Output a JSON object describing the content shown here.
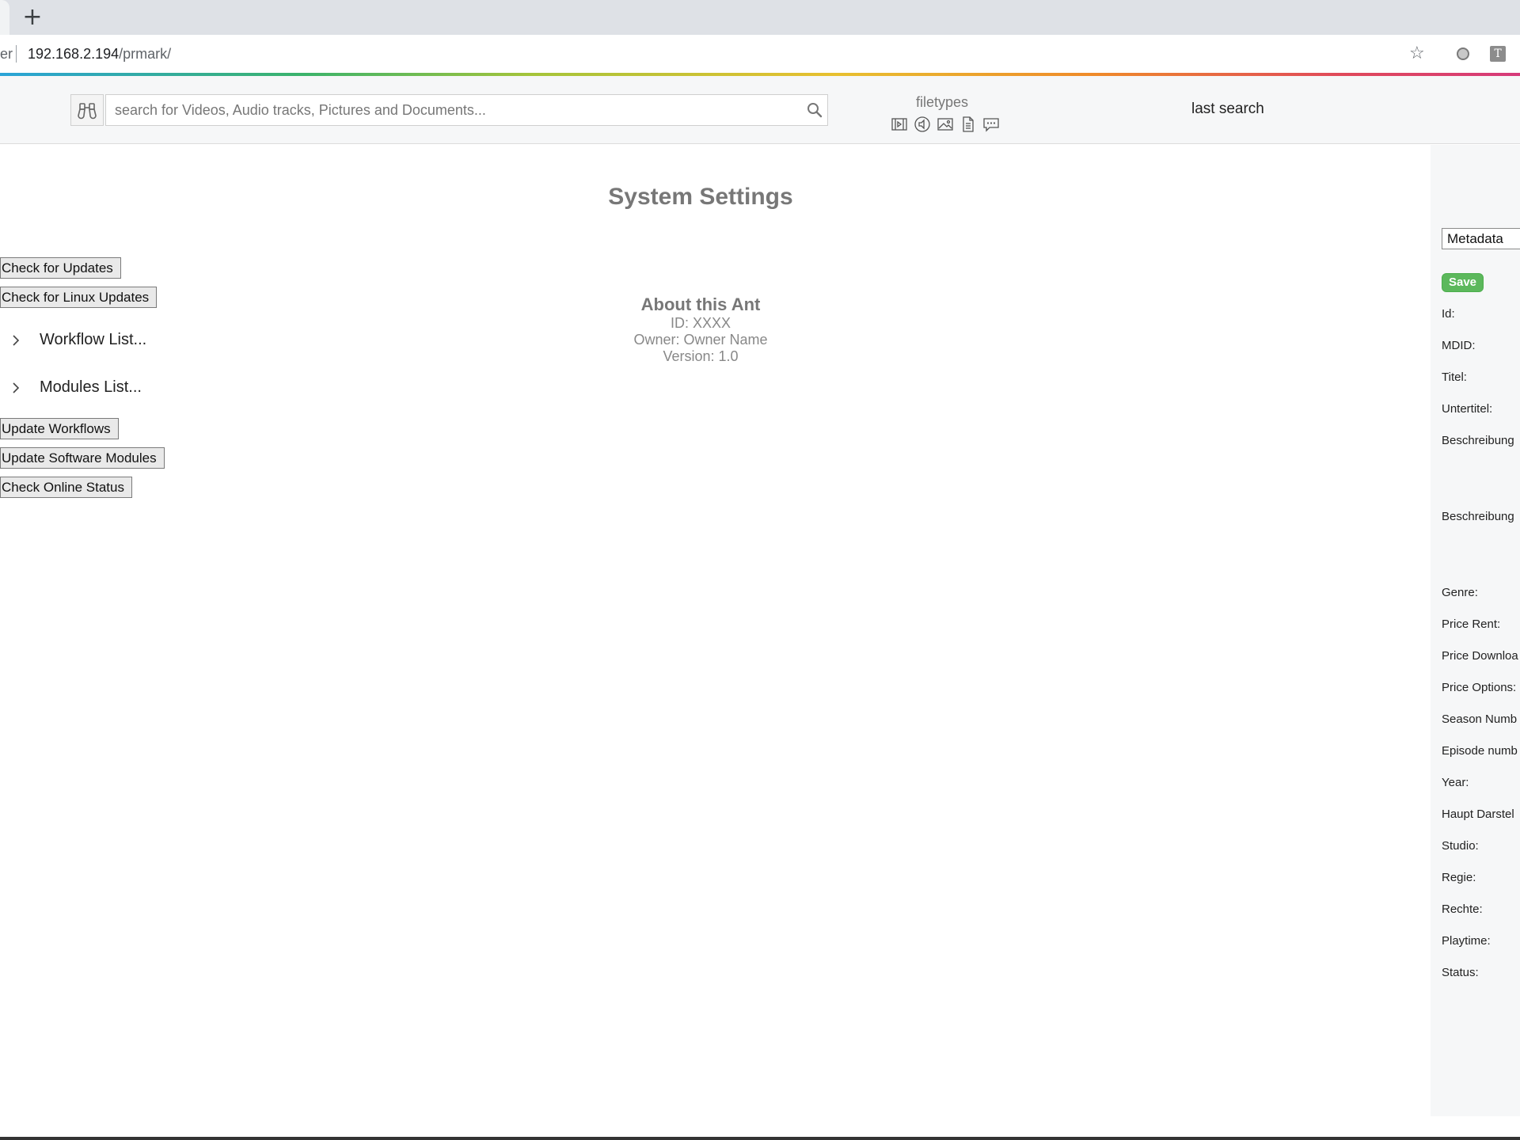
{
  "browser": {
    "new_tab": "+",
    "omnibox_prefix": "er",
    "url_host": "192.168.2.194",
    "url_path": "/prmark/",
    "extension_letter": "T"
  },
  "header": {
    "search_placeholder": "search for Videos, Audio tracks, Pictures and Documents...",
    "filetypes_label": "filetypes",
    "filetype_icons": [
      "video-icon",
      "audio-icon",
      "picture-icon",
      "document-icon",
      "comment-icon"
    ],
    "last_search_label": "last search"
  },
  "main": {
    "title": "System Settings",
    "about": {
      "title": "About this Ant",
      "id": "ID: XXXX",
      "owner": "Owner: Owner Name",
      "version": "Version: 1.0"
    }
  },
  "actions": {
    "check_updates": "Check for Updates",
    "check_linux_updates": "Check for Linux Updates",
    "workflow_list": "Workflow List...",
    "modules_list": "Modules List...",
    "update_workflows": "Update Workflows",
    "update_software_modules": "Update Software Modules",
    "check_online_status": "Check Online Status"
  },
  "metadata_panel": {
    "selector_value": "Metadata",
    "save_label": "Save",
    "fields": [
      "Id:",
      "MDID:",
      "Titel:",
      "Untertitel:",
      "Beschreibung",
      "Beschreibung",
      "Genre:",
      "Price Rent:",
      "Price Downloa",
      "Price Options:",
      "Season Numb",
      "Episode numb",
      "Year:",
      "Haupt Darstel",
      "Studio:",
      "Regie:",
      "Rechte:",
      "Playtime:",
      "Status:"
    ]
  },
  "colors": {
    "accent_green": "#5cb85c",
    "muted_text": "#777777"
  }
}
